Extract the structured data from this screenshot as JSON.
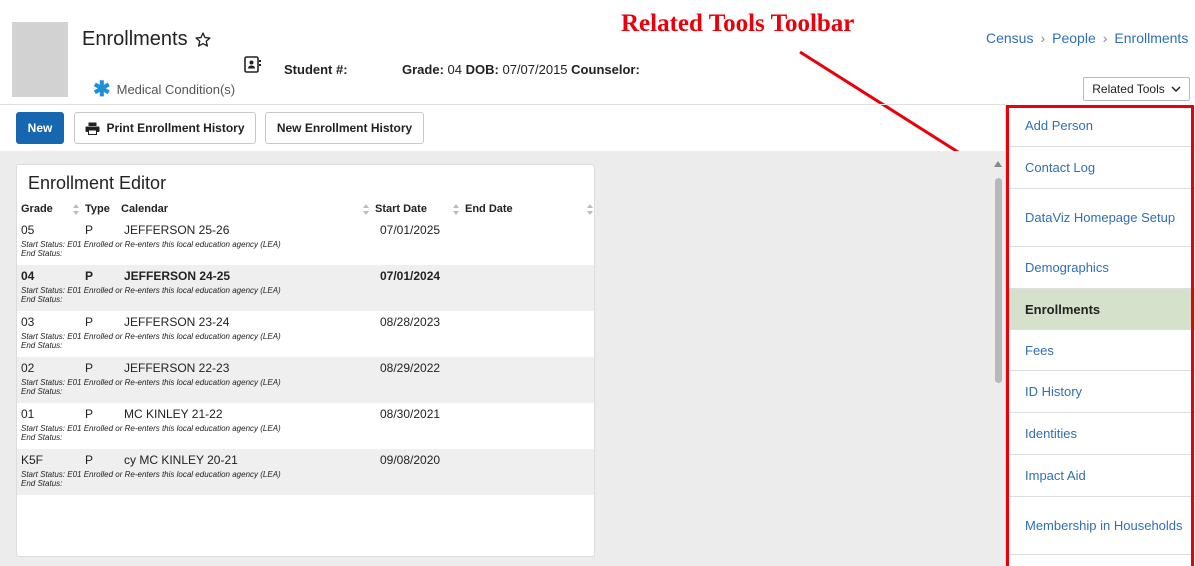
{
  "header": {
    "title": "Enrollments",
    "student_label": "Student #:",
    "grade_label": "Grade:",
    "grade_value": "04",
    "dob_label": "DOB:",
    "dob_value": "07/07/2015",
    "counselor_label": "Counselor:",
    "medical": "Medical Condition(s)"
  },
  "annotation": {
    "text": "Related Tools Toolbar",
    "color": "#e8000a"
  },
  "breadcrumb": {
    "items": [
      "Census",
      "People",
      "Enrollments"
    ]
  },
  "related_tools_button": "Related Tools",
  "toolbar": {
    "new_label": "New",
    "print_label": "Print Enrollment History",
    "new_history_label": "New Enrollment History"
  },
  "editor": {
    "title": "Enrollment Editor",
    "columns": [
      "Grade",
      "Type",
      "Calendar",
      "Start Date",
      "End Date"
    ],
    "start_status_prefix": "Start Status:",
    "end_status_label": "End Status:",
    "rows": [
      {
        "grade": "05",
        "type": "P",
        "calendar": "JEFFERSON 25-26",
        "start_date": "07/01/2025",
        "end_date": "",
        "start_status": "Start Status: E01 Enrolled or Re-enters this local education agency (LEA)",
        "end_status": "End Status:",
        "bold": false
      },
      {
        "grade": "04",
        "type": "P",
        "calendar": "JEFFERSON 24-25",
        "start_date": "07/01/2024",
        "end_date": "",
        "start_status": "Start Status: E01 Enrolled or Re-enters this local education agency (LEA)",
        "end_status": "End Status:",
        "bold": true
      },
      {
        "grade": "03",
        "type": "P",
        "calendar": "JEFFERSON 23-24",
        "start_date": "08/28/2023",
        "end_date": "",
        "start_status": "Start Status: E01 Enrolled or Re-enters this local education agency (LEA)",
        "end_status": "End Status:",
        "bold": false
      },
      {
        "grade": "02",
        "type": "P",
        "calendar": "JEFFERSON 22-23",
        "start_date": "08/29/2022",
        "end_date": "",
        "start_status": "Start Status: E01 Enrolled or Re-enters this local education agency (LEA)",
        "end_status": "End Status:",
        "bold": false
      },
      {
        "grade": "01",
        "type": "P",
        "calendar": "MC KINLEY 21-22",
        "start_date": "08/30/2021",
        "end_date": "",
        "start_status": "Start Status: E01 Enrolled or Re-enters this local education agency (LEA)",
        "end_status": "End Status:",
        "bold": false
      },
      {
        "grade": "K5F",
        "type": "P",
        "calendar": "cy MC KINLEY 20-21",
        "start_date": "09/08/2020",
        "end_date": "",
        "start_status": "Start Status: E01 Enrolled or Re-enters this local education agency (LEA)",
        "end_status": "End Status:",
        "bold": false
      }
    ]
  },
  "sidebar": {
    "items": [
      {
        "label": "Add Person",
        "active": false
      },
      {
        "label": "Contact Log",
        "active": false
      },
      {
        "label": "DataViz Homepage Setup",
        "active": false
      },
      {
        "label": "Demographics",
        "active": false
      },
      {
        "label": "Enrollments",
        "active": true
      },
      {
        "label": "Fees",
        "active": false
      },
      {
        "label": "ID History",
        "active": false
      },
      {
        "label": "Identities",
        "active": false
      },
      {
        "label": "Impact Aid",
        "active": false
      },
      {
        "label": "Membership in Households",
        "active": false
      }
    ]
  },
  "colors": {
    "accent": "#1766b0",
    "link": "#2f6fb6",
    "active_bg": "#d6e1cc",
    "annotation": "#e8000a"
  }
}
